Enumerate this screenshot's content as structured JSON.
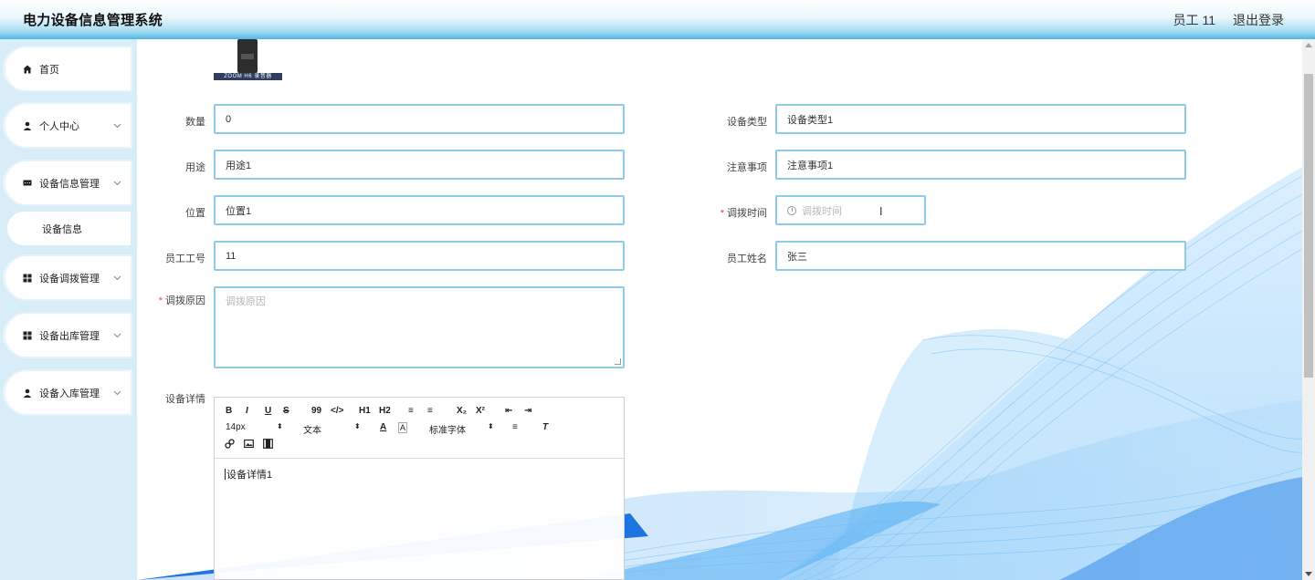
{
  "header": {
    "title": "电力设备信息管理系统",
    "user": "员工 11",
    "logout": "退出登录"
  },
  "sidebar": {
    "items": [
      {
        "label": "首页",
        "icon": "home-icon"
      },
      {
        "label": "个人中心",
        "icon": "user-icon"
      },
      {
        "label": "设备信息管理",
        "icon": "message-icon"
      },
      {
        "label": "设备调拨管理",
        "icon": "grid-icon"
      },
      {
        "label": "设备出库管理",
        "icon": "grid-icon"
      },
      {
        "label": "设备入库管理",
        "icon": "user-icon"
      }
    ],
    "sub_items": [
      {
        "label": "设备信息"
      }
    ]
  },
  "thumbnail": {
    "caption": "ZOOM H6 录音器"
  },
  "form": {
    "quantity": {
      "label": "数量",
      "value": "0"
    },
    "device_type": {
      "label": "设备类型",
      "value": "设备类型1"
    },
    "usage": {
      "label": "用途",
      "value": "用途1"
    },
    "notes": {
      "label": "注意事项",
      "value": "注意事项1"
    },
    "location": {
      "label": "位置",
      "value": "位置1"
    },
    "transfer_time": {
      "label": "调拨时间",
      "placeholder": "调拨时间",
      "required": "*"
    },
    "employee_id": {
      "label": "员工工号",
      "value": "11"
    },
    "employee_name": {
      "label": "员工姓名",
      "value": "张三"
    },
    "transfer_reason": {
      "label": "调拨原因",
      "placeholder": "调拨原因",
      "required": "*"
    },
    "device_details": {
      "label": "设备详情"
    }
  },
  "editor": {
    "toolbar": {
      "row1": [
        "B",
        "I",
        "U",
        "S",
        "99",
        "</>",
        "H1",
        "H2",
        "≡",
        "≡",
        "X₂",
        "X²",
        "⇤",
        "⇥"
      ],
      "font_size": "14px",
      "text_style": "文本",
      "font_family": "标准字体"
    },
    "content": "设备详情1"
  },
  "colors": {
    "header_gradient_end": "#4bb8e4",
    "field_border": "#8fcae8",
    "sidebar_bg": "#d8edf8",
    "required": "#e14b4b"
  }
}
